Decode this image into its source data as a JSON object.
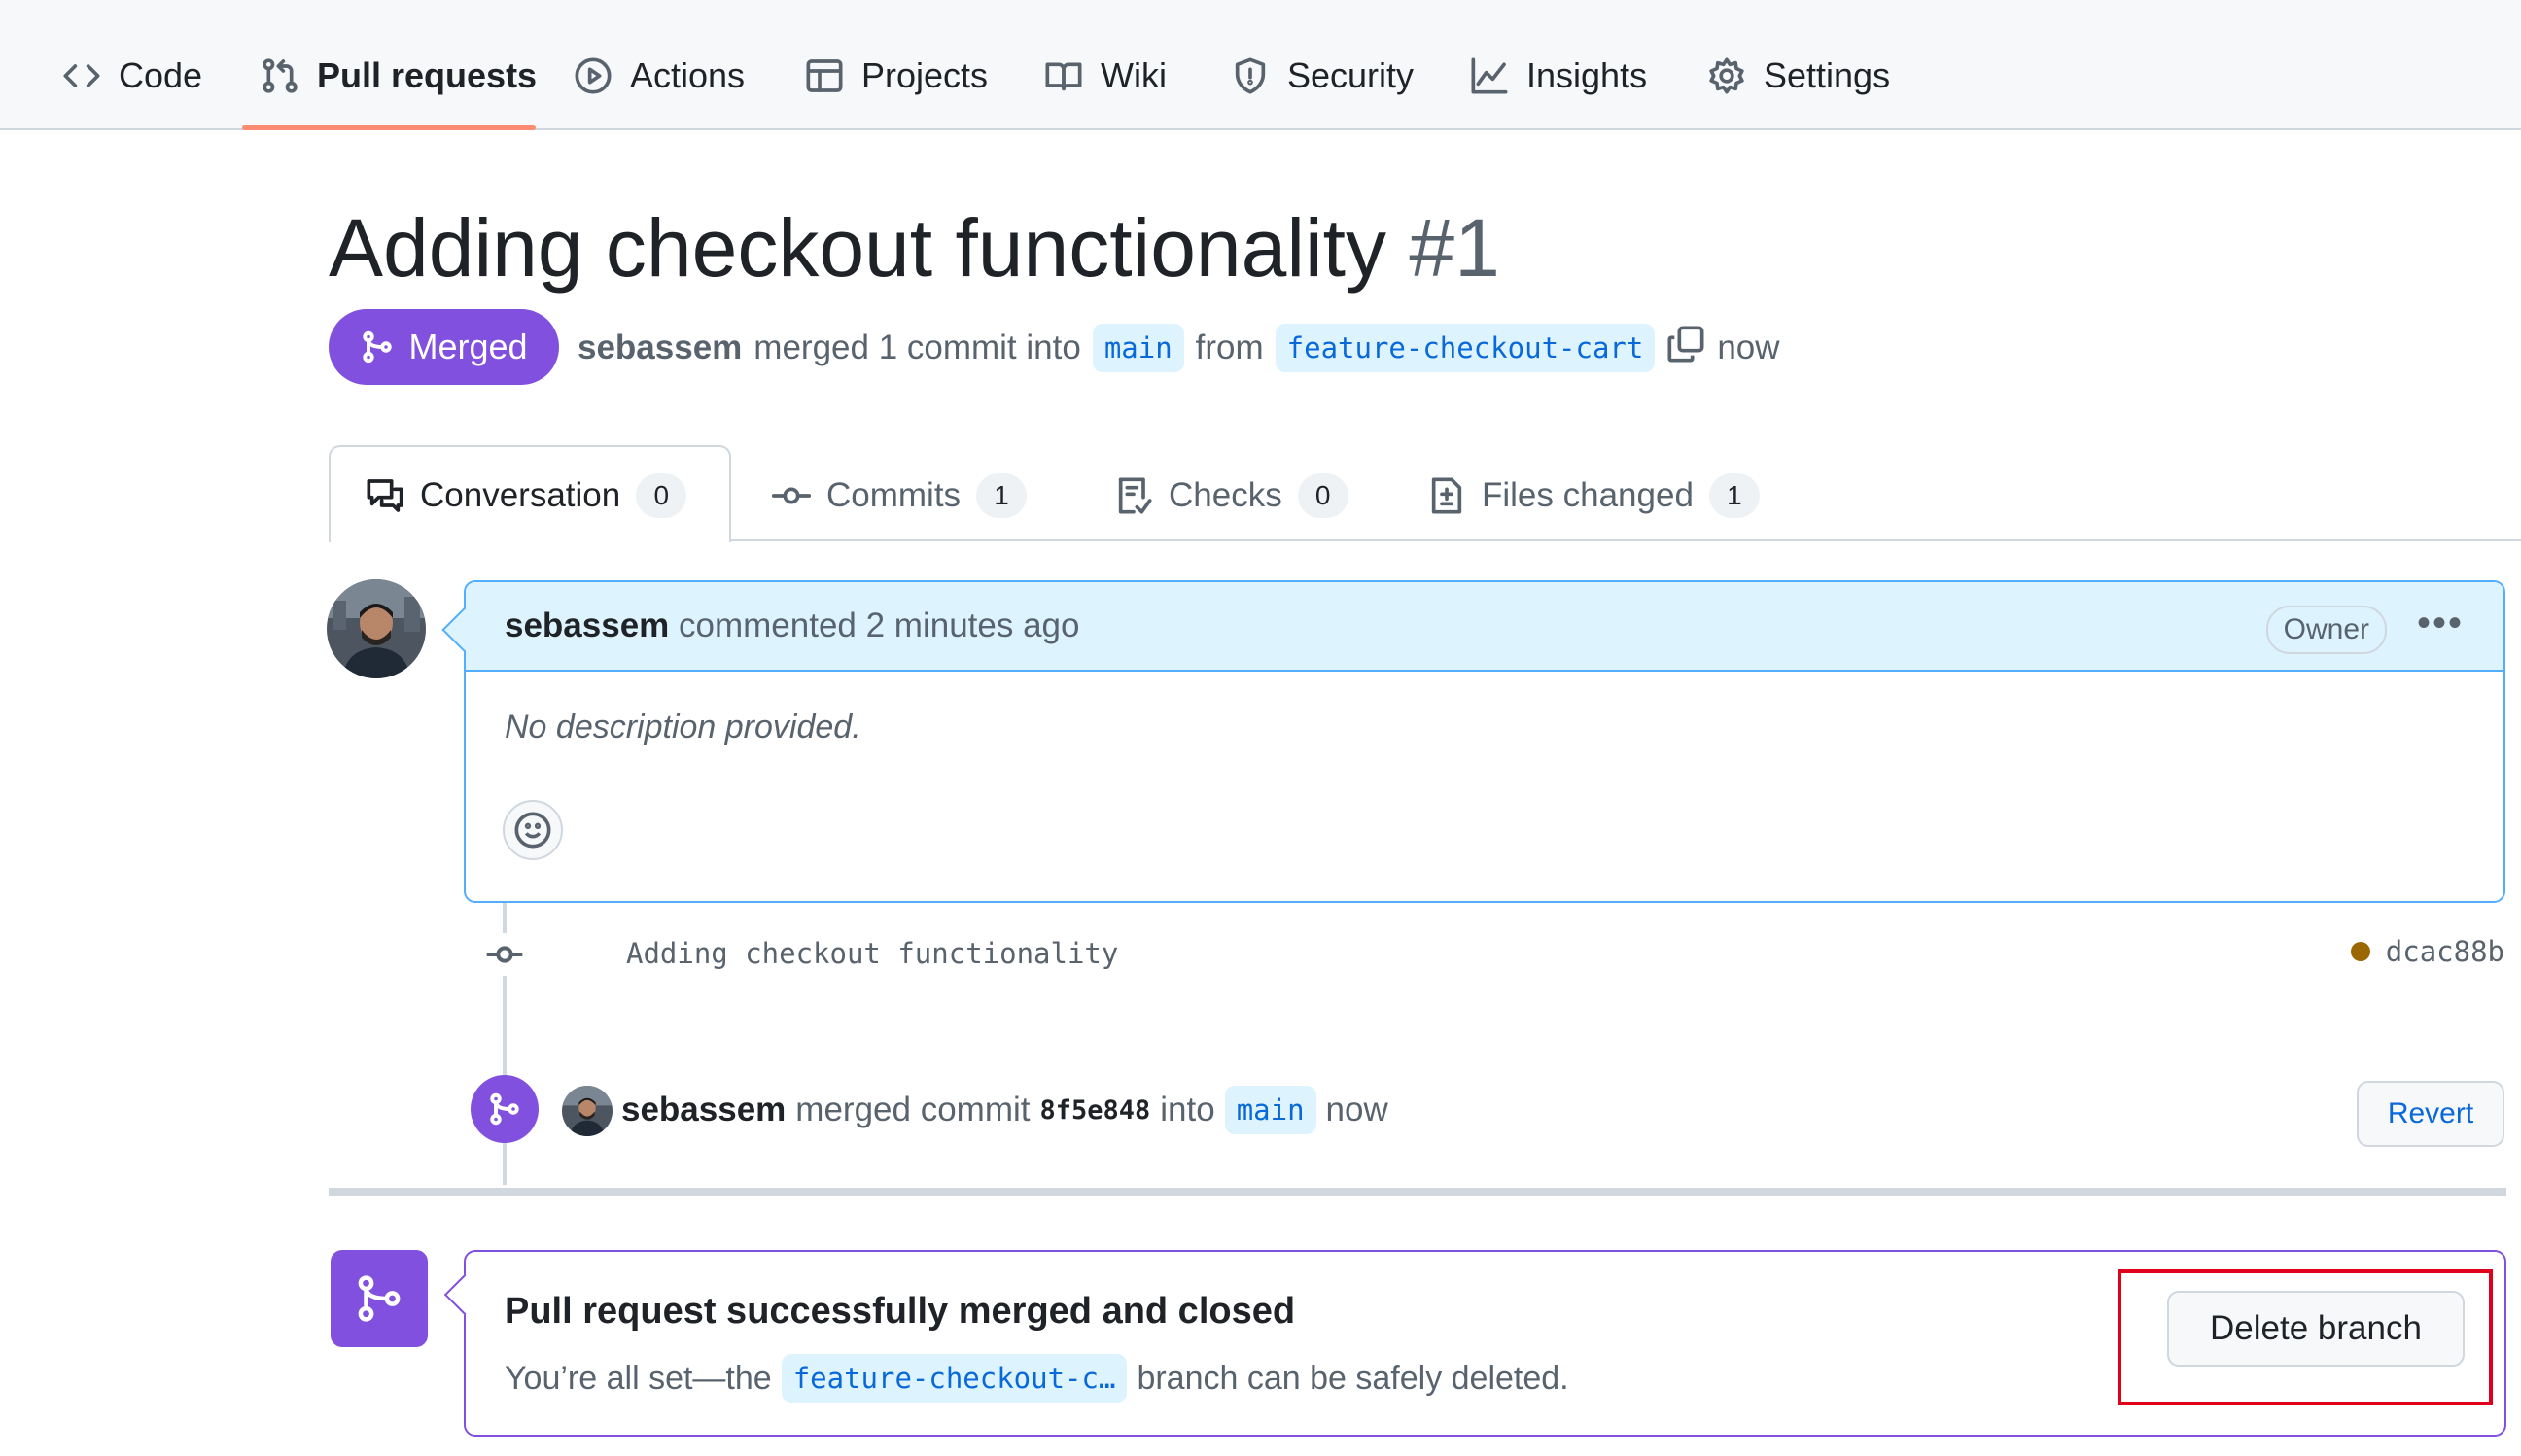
{
  "nav": {
    "items": [
      {
        "label": "Code",
        "icon": "code-icon"
      },
      {
        "label": "Pull requests",
        "icon": "pull-request-icon",
        "active": true
      },
      {
        "label": "Actions",
        "icon": "play-icon"
      },
      {
        "label": "Projects",
        "icon": "table-icon"
      },
      {
        "label": "Wiki",
        "icon": "book-icon"
      },
      {
        "label": "Security",
        "icon": "shield-icon"
      },
      {
        "label": "Insights",
        "icon": "graph-icon"
      },
      {
        "label": "Settings",
        "icon": "gear-icon"
      }
    ]
  },
  "pr": {
    "title": "Adding checkout functionality",
    "number": "#1",
    "state": "Merged",
    "author": "sebassem",
    "summary_text": "merged 1 commit into",
    "base_branch": "main",
    "from_text": "from",
    "head_branch": "feature-checkout-cart",
    "time": "now"
  },
  "tabs": [
    {
      "label": "Conversation",
      "count": "0",
      "icon": "comment-discussion-icon"
    },
    {
      "label": "Commits",
      "count": "1",
      "icon": "commit-icon"
    },
    {
      "label": "Checks",
      "count": "0",
      "icon": "checklist-icon"
    },
    {
      "label": "Files changed",
      "count": "1",
      "icon": "file-diff-icon"
    }
  ],
  "comment": {
    "author": "sebassem",
    "action": "commented 2 minutes ago",
    "role_badge": "Owner",
    "body": "No description provided."
  },
  "commit": {
    "message": "Adding checkout functionality",
    "sha": "dcac88b"
  },
  "merge_event": {
    "author": "sebassem",
    "text": "merged commit",
    "sha": "8f5e848",
    "into_text": "into",
    "branch": "main",
    "time": "now",
    "revert_label": "Revert"
  },
  "merged_box": {
    "title": "Pull request successfully merged and closed",
    "sub_prefix": "You’re all set—the",
    "branch": "feature-checkout-c…",
    "sub_suffix": "branch can be safely deleted.",
    "delete_label": "Delete branch"
  },
  "colors": {
    "merged": "#8250df",
    "link": "#0969da",
    "nav_underline": "#fd8c73",
    "highlight": "#e0001b"
  }
}
